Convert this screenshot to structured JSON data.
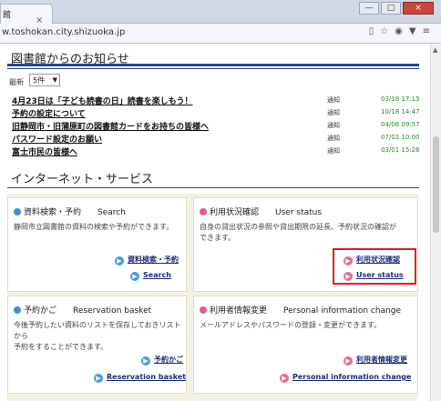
{
  "browser": {
    "tab_title": "館",
    "tab_close": "×",
    "url": "w.toshokan.city.shizuoka.jp",
    "window_minimize": "—",
    "window_maximize": "□",
    "window_close": "×"
  },
  "notices": {
    "heading": "図書館からのお知らせ",
    "count_label": "最新",
    "count_value": "5件",
    "items": [
      {
        "title": "4月23日は「子ども読書の日」読書を楽しもう！",
        "category": "通知",
        "date": "03/18 17:15"
      },
      {
        "title": "予約の設定について",
        "category": "通知",
        "date": "10/18 14:47"
      },
      {
        "title": "旧静岡市・旧蒲原町の図書館カードをお持ちの皆様へ",
        "category": "通知",
        "date": "04/06 09:57"
      },
      {
        "title": "パスワード設定のお願い",
        "category": "通知",
        "date": "07/02 10:00"
      },
      {
        "title": "富士市民の皆様へ",
        "category": "通知",
        "date": "03/01 15:26"
      }
    ]
  },
  "services": {
    "heading": "インターネット・サービス",
    "cards": {
      "search": {
        "title": "資料検索・予約　　Search",
        "desc": "静岡市立図書館の資料の検索や予約ができます。",
        "links": [
          "資料検索・予約",
          "Search"
        ]
      },
      "status": {
        "title": "利用状況確認　　User status",
        "desc": "自身の貸出状況の参照や貸出期限の延長、予約状況の確認が\nできます。",
        "links": [
          "利用状況確認",
          "User status"
        ]
      },
      "basket": {
        "title": "予約かご　　Reservation basket",
        "desc": "今後予約したい資料のリストを保存しておきリストから\n予約をすることができます。",
        "links": [
          "予約かご",
          "Reservation basket"
        ]
      },
      "personal": {
        "title": "利用者情報変更　　Personal information change",
        "desc": "メールアドレスやパスワードの登録・変更ができます。",
        "links": [
          "利用者情報変更",
          "Personal information change"
        ]
      }
    }
  }
}
